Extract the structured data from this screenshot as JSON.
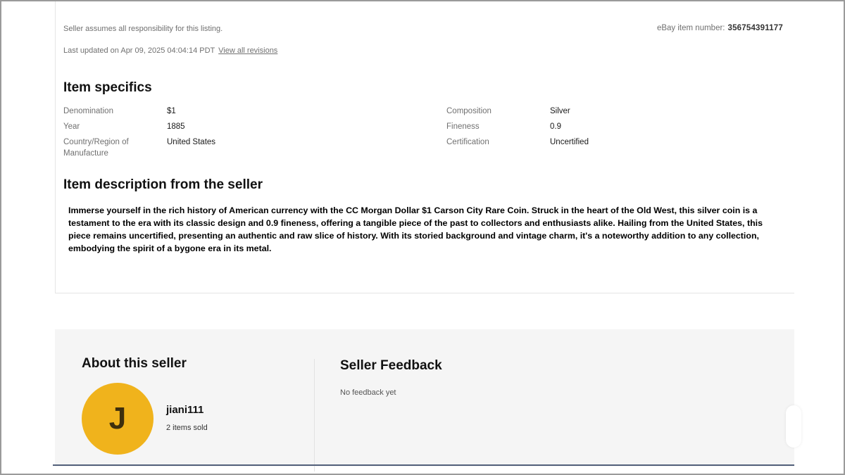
{
  "listing": {
    "disclaimer": "Seller assumes all responsibility for this listing.",
    "item_number_label": "eBay item number:",
    "item_number": "356754391177",
    "last_updated": "Last updated on Apr 09, 2025 04:04:14 PDT",
    "view_revisions": "View all revisions"
  },
  "specifics": {
    "title": "Item specifics",
    "left": [
      {
        "label": "Denomination",
        "value": "$1"
      },
      {
        "label": "Year",
        "value": "1885"
      },
      {
        "label": "Country/Region of Manufacture",
        "value": "United States"
      }
    ],
    "right": [
      {
        "label": "Composition",
        "value": "Silver"
      },
      {
        "label": "Fineness",
        "value": "0.9"
      },
      {
        "label": "Certification",
        "value": "Uncertified"
      }
    ]
  },
  "description": {
    "title": "Item description from the seller",
    "text": "Immerse yourself in the rich history of American currency with the CC Morgan Dollar $1 Carson City Rare Coin. Struck in the heart of the Old West, this silver coin is a testament to the era with its classic design and 0.9 fineness, offering a tangible piece of the past to collectors and enthusiasts alike. Hailing from the United States, this piece remains uncertified, presenting an authentic and raw slice of history. With its storied background and vintage charm, it's a noteworthy addition to any collection, embodying the spirit of a bygone era in its metal."
  },
  "seller": {
    "title": "About this seller",
    "avatar_letter": "J",
    "avatar_color": "#f0b31c",
    "name": "jiani111",
    "items_sold": "2 items sold"
  },
  "feedback": {
    "title": "Seller Feedback",
    "empty_text": "No feedback yet"
  }
}
